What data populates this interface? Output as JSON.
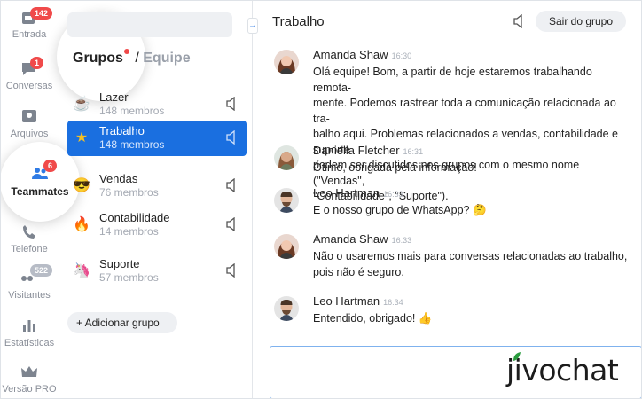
{
  "sidebar": {
    "items": [
      {
        "label": "Entrada",
        "icon": "inbox-icon",
        "badge": "142"
      },
      {
        "label": "Conversas",
        "icon": "chat-bubble-icon",
        "badge": "1"
      },
      {
        "label": "Arquivos",
        "icon": "archive-icon",
        "badge": ""
      },
      {
        "label": "Teammates",
        "icon": "users-icon",
        "badge": "6"
      },
      {
        "label": "Telefone",
        "icon": "phone-icon",
        "badge": ""
      },
      {
        "label": "Visitantes",
        "icon": "visitors-icon",
        "badge": "522"
      },
      {
        "label": "Estatísticas",
        "icon": "stats-icon",
        "badge": ""
      },
      {
        "label": "Versão PRO",
        "icon": "crown-icon",
        "badge": ""
      }
    ]
  },
  "groups_panel": {
    "tab_groups": "Grupos",
    "tab_separator": "/",
    "tab_team": "Equipe",
    "groups": [
      {
        "name": "Lazer",
        "count": "148 membros",
        "icon": "coffee-icon",
        "emoji": "☕"
      },
      {
        "name": "Trabalho",
        "count": "148 membros",
        "icon": "star-icon",
        "emoji": "★"
      },
      {
        "name": "Vendas",
        "count": "76 membros",
        "icon": "sunglasses-icon",
        "emoji": "😎"
      },
      {
        "name": "Contabilidade",
        "count": "14 membros",
        "icon": "fire-icon",
        "emoji": "🔥"
      },
      {
        "name": "Suporte",
        "count": "57 membros",
        "icon": "unicorn-icon",
        "emoji": "🦄"
      }
    ],
    "add_group_label": "+ Adicionar grupo"
  },
  "chat": {
    "title": "Trabalho",
    "leave_label": "Sair do grupo",
    "messages": [
      {
        "author": "Amanda Shaw",
        "time": "16:30",
        "text": "Olá equipe! Bom, a partir de hoje estaremos trabalhando remota-\nmente. Podemos rastrear toda a comunicação relacionada ao tra-\nbalho aqui. Problemas relacionados a vendas, contabilidade e suporte\npodem ser discutidos nos grupos com o mesmo nome (\"Vendas\",\n\"Contabilidade\", \"Suporte\")."
      },
      {
        "author": "Daniella Fletcher",
        "time": "16:31",
        "text": "Ótimo, obrigada pela informação!"
      },
      {
        "author": "Leo Hartman",
        "time": "16:33",
        "text": "E o nosso grupo de WhatsApp? 🤔"
      },
      {
        "author": "Amanda Shaw",
        "time": "16:33",
        "text": "Não o usaremos mais para conversas relacionadas ao trabalho,\npois não é seguro."
      },
      {
        "author": "Leo Hartman",
        "time": "16:34",
        "text": "Entendido, obrigado! 👍"
      }
    ]
  },
  "branding": {
    "logo": "jivochat"
  },
  "colors": {
    "accent": "#1a6fe0",
    "badge": "#f04a4a",
    "logo_green": "#2a9c3e"
  }
}
